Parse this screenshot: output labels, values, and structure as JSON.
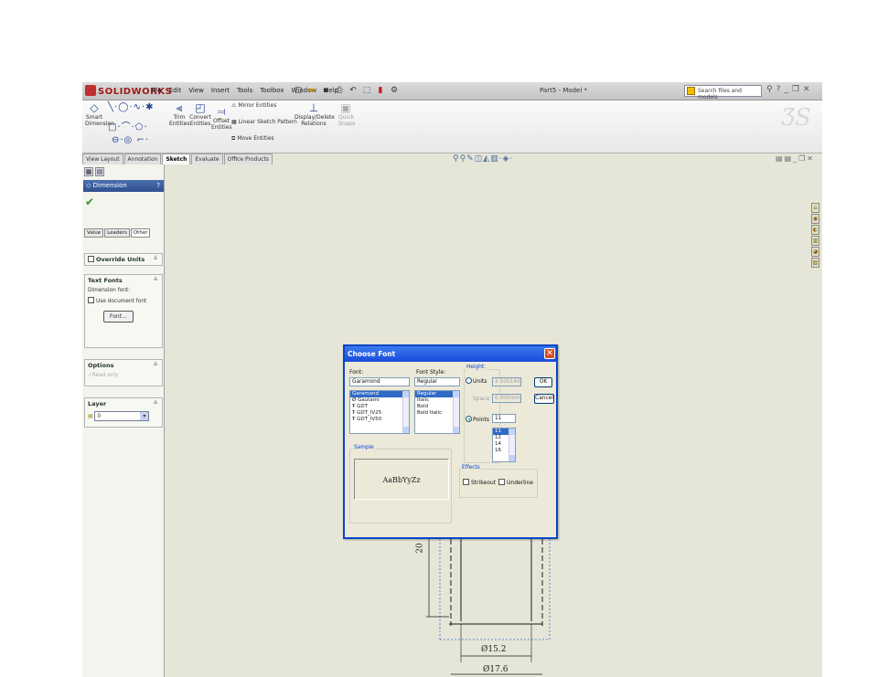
{
  "app": {
    "brand": "SOLIDWORKS",
    "doc_title": "Part5 - Model *"
  },
  "menu": [
    "File",
    "Edit",
    "View",
    "Insert",
    "Tools",
    "Toolbox",
    "Window",
    "Help"
  ],
  "search": {
    "placeholder": "Search files and models"
  },
  "ribbon": {
    "smart_dimension": "Smart Dimension",
    "trim": "Trim Entities",
    "convert": "Convert Entities",
    "offset": "Offset Entities",
    "mirror": "Mirror Entities",
    "linear_pattern": "Linear Sketch Pattern",
    "move": "Move Entities",
    "display_delete": "Display/Delete Relations",
    "quick_snaps": "Quick Snaps"
  },
  "command_tabs": [
    "View Layout",
    "Annotation",
    "Sketch",
    "Evaluate",
    "Office Products"
  ],
  "command_tabs_active": "Sketch",
  "property_manager": {
    "title": "Dimension",
    "help": "?",
    "subtabs": [
      "Value",
      "Leaders",
      "Other"
    ],
    "override_units": "Override Units",
    "text_fonts": {
      "title": "Text Fonts",
      "dimension_font": "Dimension font:",
      "use_document_font": "Use document font",
      "font_button": "Font..."
    },
    "options": {
      "title": "Options",
      "read_only": "Read only"
    },
    "layer": {
      "title": "Layer",
      "value": "0"
    }
  },
  "dialog": {
    "title": "Choose Font",
    "font_label": "Font:",
    "font_value": "Garamond",
    "fonts": [
      "Garamond",
      "Gautami",
      "GDT",
      "GDT_IV25",
      "GDT_IV50"
    ],
    "style_label": "Font Style:",
    "style_value": "Regular",
    "styles": [
      "Regular",
      "Italic",
      "Bold",
      "Bold Italic"
    ],
    "height_label": "Height:",
    "units_label": "Units",
    "units_value": "2.500140t",
    "space_label": "Space",
    "space_value": "0.000mm",
    "points_label": "Points",
    "points_value": "11",
    "sizes": [
      "11",
      "12",
      "14",
      "16"
    ],
    "ok": "OK",
    "cancel": "Cancel",
    "sample_label": "Sample",
    "sample_text": "AaBbYyZz",
    "effects_label": "Effects",
    "strikeout": "Strikeout",
    "underline": "Underline"
  },
  "sketch": {
    "dim_vertical": "20",
    "dim_inner": "Ø15.2",
    "dim_outer": "Ø17.6"
  }
}
